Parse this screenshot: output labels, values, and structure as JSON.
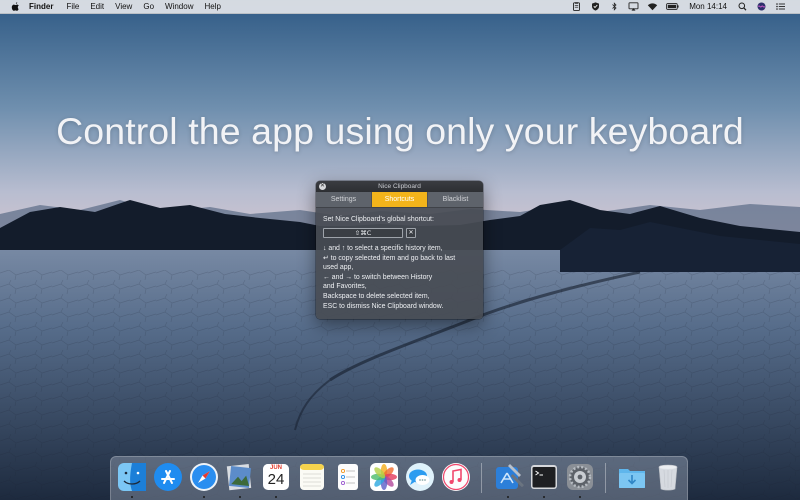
{
  "menubar": {
    "app_name": "Finder",
    "menus": [
      "File",
      "Edit",
      "View",
      "Go",
      "Window",
      "Help"
    ],
    "clock": "Mon 14:14",
    "status_icons": [
      "clipboard-icon",
      "shield-icon",
      "bluetooth-icon",
      "airplay-icon",
      "wifi-icon",
      "battery-icon",
      "spotlight-icon",
      "siri-icon",
      "notification-center-icon"
    ]
  },
  "headline": "Control the app using only your keyboard",
  "clip_window": {
    "title": "Nice Clipboard",
    "close_glyph": "✕",
    "tabs": [
      {
        "label": "Settings",
        "active": false
      },
      {
        "label": "Shortcuts",
        "active": true
      },
      {
        "label": "Blacklist",
        "active": false
      }
    ],
    "prompt": "Set Nice Clipboard's global shortcut:",
    "shortcut_value": "⇧⌘C",
    "clear_glyph": "✕",
    "help_lines": [
      "↓ and ↑ to select a specific history item,",
      "↵ to copy selected item and go back to last",
      "used app,",
      "← and → to switch between History",
      "and Favorites,",
      "Backspace to delete selected item,",
      "ESC to dismiss Nice Clipboard window."
    ],
    "accent_color": "#f3b41b"
  },
  "dock": {
    "calendar_month": "JUN",
    "calendar_day": "24",
    "apps": [
      {
        "icon": "finder-icon",
        "running": true
      },
      {
        "icon": "app-store-icon",
        "running": false
      },
      {
        "icon": "safari-icon",
        "running": true
      },
      {
        "icon": "preview-icon",
        "running": true
      },
      {
        "icon": "calendar-icon",
        "running": true
      },
      {
        "icon": "notes-icon",
        "running": false
      },
      {
        "icon": "reminders-icon",
        "running": false
      },
      {
        "icon": "photos-icon",
        "running": false
      },
      {
        "icon": "messages-icon",
        "running": false
      },
      {
        "icon": "itunes-icon",
        "running": false
      },
      {
        "icon": "xcode-icon",
        "running": true
      },
      {
        "icon": "terminal-icon",
        "running": true
      },
      {
        "icon": "system-preferences-icon",
        "running": true
      },
      {
        "icon": "downloads-folder-icon",
        "running": false
      },
      {
        "icon": "trash-icon",
        "running": false
      }
    ]
  }
}
